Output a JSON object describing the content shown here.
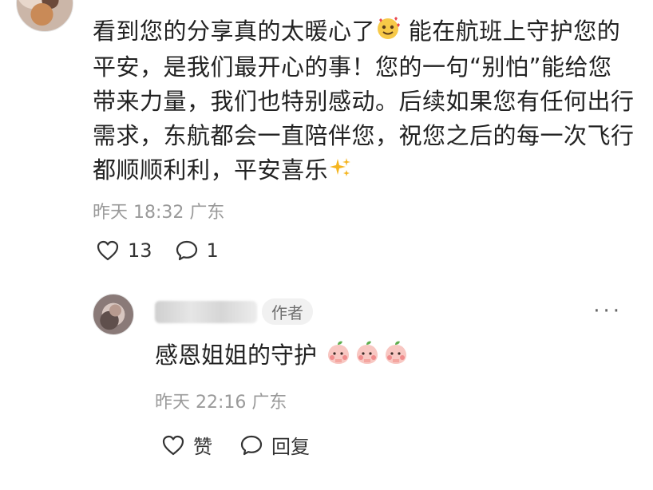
{
  "comment": {
    "text_part1": "看到您的分享真的太暖心了",
    "text_part2": " 能在航班上守护您的平安，是我们最开心的事！您的一句“别怕”能给您带来力量，我们也特别感动。后续如果您有任何出行需求，东航都会一直陪伴您，祝您之后的每一次飞行都顺顺利利，平安喜乐",
    "emoji_1": "smiling-face-with-hearts",
    "emoji_2": "sparkles",
    "time": "昨天 18:32",
    "location": "广东",
    "like_count": "13",
    "reply_count": "1"
  },
  "reply": {
    "author_badge": "作者",
    "text": "感恩姐姐的守护",
    "emoji": "face-with-hand-over-mouth-peach",
    "time": "昨天 22:16",
    "location": "广东",
    "like_label": "赞",
    "reply_label": "回复"
  },
  "icons": {
    "heart": "heart-outline-icon",
    "comment": "comment-bubble-icon",
    "more": "more-dots-icon"
  }
}
